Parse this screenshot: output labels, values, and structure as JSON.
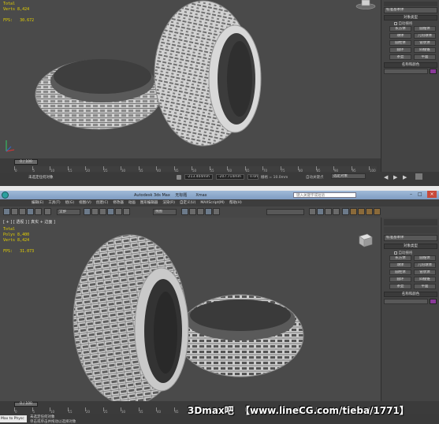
{
  "top": {
    "viewport_stats": "Total\nVerts 8,424\n\nFPS:   30.672",
    "panel": {
      "dropdown": "标准基本体",
      "section_object_type": "对象类型",
      "autogrid": "自动栅格",
      "buttons": [
        "长方体",
        "圆锥体",
        "球体",
        "几何球体",
        "圆柱体",
        "管状体",
        "圆环",
        "四棱锥",
        "茶壶",
        "平面"
      ],
      "section_name_color": "名称和颜色"
    },
    "timeline": {
      "frame": "0 / 100",
      "ticks": [
        "0",
        "5",
        "10",
        "15",
        "20",
        "25",
        "30",
        "35",
        "40",
        "45",
        "50",
        "55",
        "60",
        "65",
        "70",
        "75",
        "80",
        "85",
        "90",
        "95",
        "100"
      ]
    },
    "status": {
      "prompt": "未选定任何对象",
      "x": "-213.404mm",
      "y": "-207.714mm",
      "z": "0.0mm",
      "grid": "栅格 = 10.0mm",
      "autokey": "自动关键点",
      "selset": "选定对象"
    }
  },
  "bottom": {
    "title": "Autodesk 3ds Max    无标题       Xmax",
    "search_placeholder": "键入关键字或短语",
    "menu": [
      "编辑(E)",
      "工具(T)",
      "组(G)",
      "视图(V)",
      "创建(C)",
      "修改器",
      "动画",
      "图形编辑器",
      "渲染(R)",
      "自定义(U)",
      "MAXScript(M)",
      "帮助(H)"
    ],
    "toolbar": {
      "filter": "全部",
      "ref": "视图"
    },
    "viewport_label": "[ + ] [ 透视 ] [ 真实 + 边面 ]",
    "viewport_stats": "Total\nPolys 8,400\nVerts 8,424\n\nFPS:   31.073",
    "panel": {
      "dropdown": "标准基本体",
      "section_object_type": "对象类型",
      "autogrid": "自动栅格",
      "buttons": [
        "长方体",
        "圆锥体",
        "球体",
        "几何球体",
        "圆柱体",
        "管状体",
        "圆环",
        "四棱锥",
        "茶壶",
        "平面"
      ],
      "section_name_color": "名称和颜色"
    },
    "timeline": {
      "frame": "0 / 100",
      "ticks": [
        "0",
        "5",
        "10",
        "15",
        "20",
        "25",
        "30",
        "35",
        "40",
        "45",
        "50",
        "55",
        "60",
        "65",
        "70",
        "75",
        "80",
        "85",
        "90",
        "95",
        "100"
      ]
    },
    "status": {
      "script": "Max to Physc",
      "prompt": "未选定任何对象",
      "hint": "单击或单击并拖动以选择对象"
    }
  },
  "watermark": "3Dmax吧  【www.lineCG.com/tieba/1771】",
  "colors": {
    "accent": "#e6d200",
    "viewport": "#4a4a4a",
    "panel": "#444444",
    "tire": "#c8c8c8"
  }
}
